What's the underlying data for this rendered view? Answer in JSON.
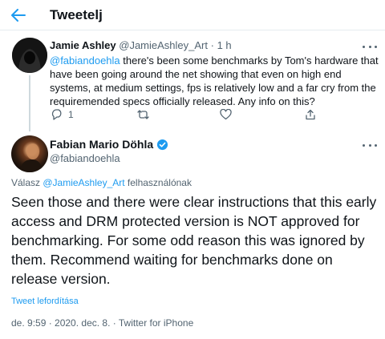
{
  "header": {
    "title": "Tweetelj",
    "back_icon": "arrow-left-icon",
    "accent": "#1d9bf0"
  },
  "reply_tweet": {
    "author_name": "Jamie Ashley",
    "author_handle": "@JamieAshley_Art",
    "separator": " · ",
    "time_ago": "1 h",
    "mention": "@fabiandoehla",
    "text": " there's been some benchmarks by Tom's hardware that have been going around the net showing that even on high end systems, at medium settings, fps is relatively low and a far cry from the requiremended specs officially released. Any info on this?",
    "reply_count": "1",
    "retweet_count": "",
    "like_count": ""
  },
  "main_tweet": {
    "author_name": "Fabian Mario Döhla",
    "author_handle": "@fabiandoehla",
    "verified_icon": "verified-badge-icon",
    "replying_prefix": "Válasz ",
    "replying_mention": "@JamieAshley_Art",
    "replying_suffix": " felhasználónak",
    "text": "Seen those and there were clear instructions that this early access and DRM protected version is NOT approved for benchmarking. For some odd reason this was ignored by them. Recommend waiting for benchmarks done on release version.",
    "translate_label": "Tweet lefordítása",
    "timestamp": "de. 9:59 · 2020. dec. 8. · Twitter for iPhone"
  }
}
